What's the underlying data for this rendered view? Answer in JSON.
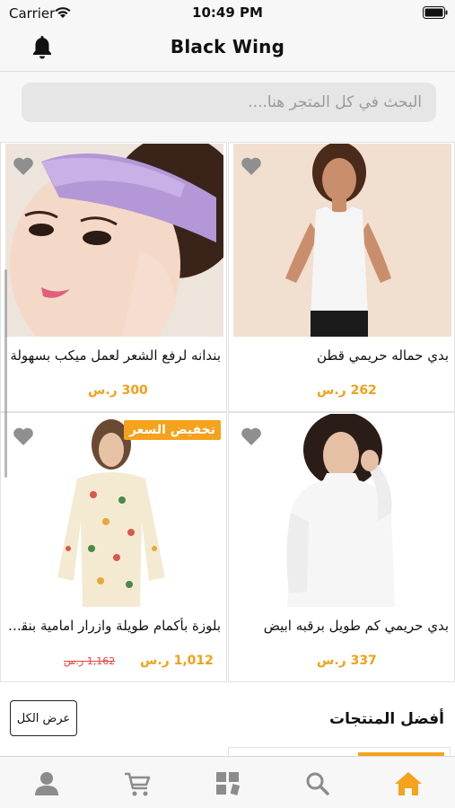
{
  "status_bar": {
    "carrier": "Carrier",
    "time": "10:49 PM"
  },
  "header": {
    "title": "Black Wing",
    "icon": "bell-icon"
  },
  "search": {
    "placeholder": "البحث في كل المتجر هنا...."
  },
  "products": [
    {
      "name": "بندانه لرفع الشعر لعمل ميكب بسهولة",
      "price": "300 ر.س",
      "old_price": "",
      "badge": ""
    },
    {
      "name": "بدي حماله حريمي قطن",
      "price": "262 ر.س",
      "old_price": "",
      "badge": ""
    },
    {
      "name": "بلوزة بأكمام طويلة وازرار امامية بنقشة",
      "price": "1,012 ر.س",
      "old_price": "1,162 ر.س",
      "badge": "تخفيض السعر"
    },
    {
      "name": "بدي حريمي كم طويل برقبه ابيض",
      "price": "337 ر.س",
      "old_price": "",
      "badge": ""
    }
  ],
  "best_products": {
    "title": "أفضل المنتجات",
    "show_all_label": "عرض الكل"
  },
  "tab_bar": {
    "items": [
      "profile-icon",
      "cart-icon",
      "categories-icon",
      "search-icon",
      "home-icon"
    ]
  },
  "colors": {
    "accent": "#f5a21c",
    "price": "#f0a019",
    "old_price": "#e74040",
    "heart": "#8f8f8f",
    "active_tab": "#f5a21c",
    "inactive_tab": "#8c8c8c"
  }
}
